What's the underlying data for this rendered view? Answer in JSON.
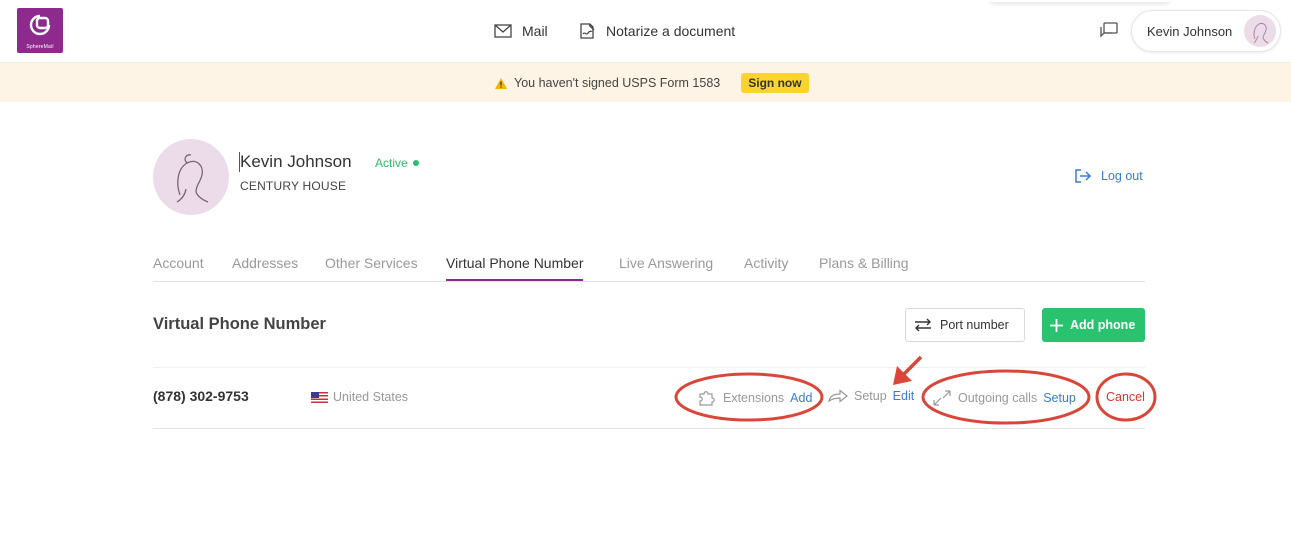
{
  "header": {
    "logo_text": "SphereMail",
    "nav": [
      {
        "label": "Mail",
        "icon": "envelope-icon"
      },
      {
        "label": "Notarize a document",
        "icon": "notarize-icon"
      }
    ],
    "user_name": "Kevin Johnson"
  },
  "banner": {
    "message": "You haven't signed USPS Form 1583",
    "button": "Sign now"
  },
  "profile": {
    "name": "Kevin Johnson",
    "status": "Active",
    "company": "CENTURY HOUSE",
    "logout": "Log out"
  },
  "tabs": [
    {
      "label": "Account",
      "active": false
    },
    {
      "label": "Addresses",
      "active": false
    },
    {
      "label": "Other Services",
      "active": false
    },
    {
      "label": "Virtual Phone Number",
      "active": true
    },
    {
      "label": "Live Answering",
      "active": false
    },
    {
      "label": "Activity",
      "active": false
    },
    {
      "label": "Plans & Billing",
      "active": false
    }
  ],
  "section": {
    "title": "Virtual Phone Number",
    "port_button": "Port number",
    "add_button": "Add phone"
  },
  "phone_row": {
    "number": "(878) 302-9753",
    "country": "United States",
    "extensions_label": "Extensions",
    "extensions_link": "Add",
    "setup_label": "Setup",
    "setup_link": "Edit",
    "outgoing_label": "Outgoing calls",
    "outgoing_link": "Setup",
    "cancel": "Cancel"
  },
  "colors": {
    "brand": "#8e2a8e",
    "link": "#3a7bd5",
    "success": "#29c370",
    "warning": "#fbd42c",
    "danger": "#d9362b",
    "annotation": "#d9473b"
  }
}
